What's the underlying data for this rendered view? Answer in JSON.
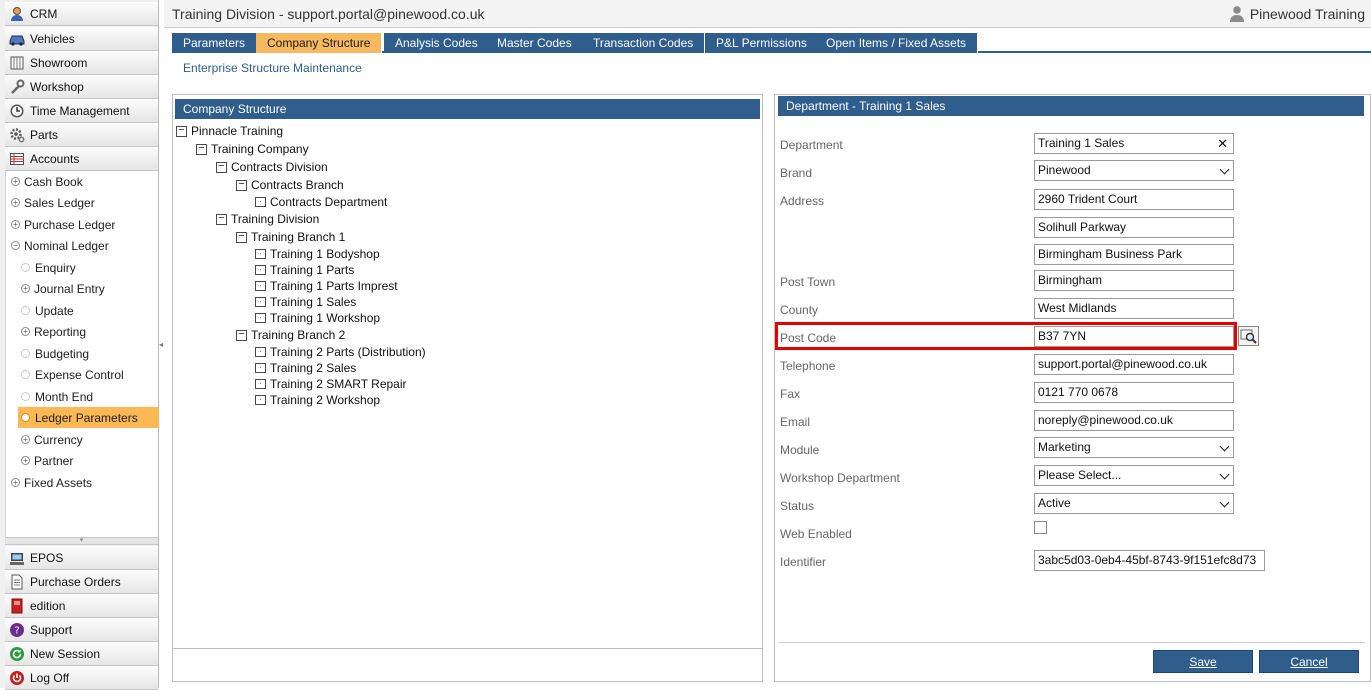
{
  "sidebar": {
    "modules_top": [
      {
        "label": "CRM",
        "icon": "crm-user-icon"
      },
      {
        "label": "Vehicles",
        "icon": "car-icon"
      },
      {
        "label": "Showroom",
        "icon": "showroom-icon"
      },
      {
        "label": "Workshop",
        "icon": "wrench-icon"
      },
      {
        "label": "Time Management",
        "icon": "clock-icon"
      },
      {
        "label": "Parts",
        "icon": "gear-icon"
      },
      {
        "label": "Accounts",
        "icon": "ledger-icon"
      }
    ],
    "accounts_tree": [
      {
        "label": "Cash Book",
        "marker": "+"
      },
      {
        "label": "Sales Ledger",
        "marker": "+"
      },
      {
        "label": "Purchase Ledger",
        "marker": "+"
      },
      {
        "label": "Nominal Ledger",
        "marker": "−"
      },
      {
        "label": "Enquiry",
        "marker": ""
      },
      {
        "label": "Journal Entry",
        "marker": "+"
      },
      {
        "label": "Update",
        "marker": ""
      },
      {
        "label": "Reporting",
        "marker": "+"
      },
      {
        "label": "Budgeting",
        "marker": ""
      },
      {
        "label": "Expense Control",
        "marker": ""
      },
      {
        "label": "Month End",
        "marker": ""
      },
      {
        "label": "Ledger Parameters",
        "marker": ""
      },
      {
        "label": "Currency",
        "marker": "+"
      },
      {
        "label": "Partner",
        "marker": "+"
      },
      {
        "label": "Fixed Assets",
        "marker": "+"
      }
    ],
    "modules_bottom": [
      {
        "label": "EPOS",
        "icon": "epos-icon"
      },
      {
        "label": "Purchase Orders",
        "icon": "document-icon"
      },
      {
        "label": "edition",
        "icon": "book-icon"
      },
      {
        "label": "Support",
        "icon": "support-icon"
      },
      {
        "label": "New Session",
        "icon": "refresh-icon"
      },
      {
        "label": "Log Off",
        "icon": "power-icon"
      }
    ]
  },
  "header": {
    "title": "Training Division - support.portal@pinewood.co.uk",
    "user_name": "Pinewood Training"
  },
  "tabs": [
    "Parameters",
    "Company Structure",
    "Analysis Codes",
    "Master Codes",
    "Transaction Codes",
    "P&L Permissions",
    "Open Items / Fixed Assets"
  ],
  "active_tab": "Company Structure",
  "subtitle": "Enterprise Structure Maintenance",
  "company_structure": {
    "heading": "Company Structure",
    "nodes": [
      {
        "label": "Pinnacle Training",
        "marker": "−"
      },
      {
        "label": "Training Company",
        "marker": "−"
      },
      {
        "label": "Contracts Division",
        "marker": "−"
      },
      {
        "label": "Contracts Branch",
        "marker": "−"
      },
      {
        "label": "Contracts Department",
        "marker": "·"
      },
      {
        "label": "Training Division",
        "marker": "−"
      },
      {
        "label": "Training Branch 1",
        "marker": "−"
      },
      {
        "label": "Training 1 Bodyshop",
        "marker": "·"
      },
      {
        "label": "Training 1 Parts",
        "marker": "·"
      },
      {
        "label": "Training 1 Parts Imprest",
        "marker": "·"
      },
      {
        "label": "Training 1 Sales",
        "marker": "·"
      },
      {
        "label": "Training 1 Workshop",
        "marker": "·"
      },
      {
        "label": "Training Branch 2",
        "marker": "−"
      },
      {
        "label": "Training 2 Parts (Distribution)",
        "marker": "·"
      },
      {
        "label": "Training 2 Sales",
        "marker": "·"
      },
      {
        "label": "Training 2 SMART Repair",
        "marker": "·"
      },
      {
        "label": "Training 2 Workshop",
        "marker": "·"
      }
    ]
  },
  "department": {
    "heading": "Department - Training 1 Sales",
    "fields": {
      "department": {
        "label": "Department",
        "value": "Training 1 Sales",
        "clear": "✕"
      },
      "brand": {
        "label": "Brand",
        "value": "Pinewood"
      },
      "address": {
        "label": "Address",
        "line1": "2960 Trident Court",
        "line2": "Solihull Parkway",
        "line3": "Birmingham Business Park"
      },
      "post_town": {
        "label": "Post Town",
        "value": "Birmingham"
      },
      "county": {
        "label": "County",
        "value": "West Midlands"
      },
      "post_code": {
        "label": "Post Code",
        "value": "B37 7YN"
      },
      "telephone": {
        "label": "Telephone",
        "value": "support.portal@pinewood.co.uk"
      },
      "fax": {
        "label": "Fax",
        "value": "0121 770 0678"
      },
      "email": {
        "label": "Email",
        "value": "noreply@pinewood.co.uk"
      },
      "module": {
        "label": "Module",
        "value": "Marketing"
      },
      "workshop_department": {
        "label": "Workshop Department",
        "value": "Please Select..."
      },
      "status": {
        "label": "Status",
        "value": "Active"
      },
      "web_enabled": {
        "label": "Web Enabled",
        "checked": false
      },
      "identifier": {
        "label": "Identifier",
        "value": "3abc5d03-0eb4-45bf-8743-9f151efc8d73"
      }
    },
    "buttons": {
      "save": "Save",
      "cancel": "Cancel"
    }
  },
  "colors": {
    "accent_blue": "#2f5d8c",
    "active_orange": "#f7b960",
    "highlight_red": "#e60000"
  }
}
